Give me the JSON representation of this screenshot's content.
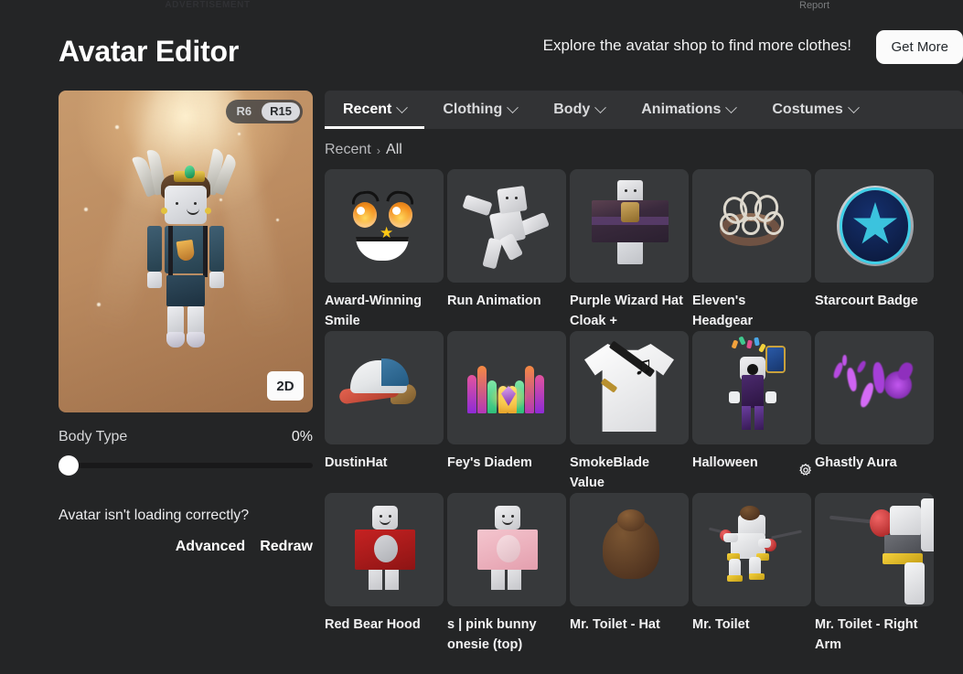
{
  "top": {
    "advertisement_label": "ADVERTISEMENT",
    "report_label": "Report"
  },
  "header": {
    "title": "Avatar Editor",
    "promo_text": "Explore the avatar shop to find more clothes!",
    "get_more_label": "Get More"
  },
  "avatar_panel": {
    "rig_options": [
      {
        "label": "R6",
        "active": false
      },
      {
        "label": "R15",
        "active": true
      }
    ],
    "view_toggle_label": "2D",
    "body_type_label": "Body Type",
    "body_type_value": "0%",
    "body_type_percent": 0,
    "loading_question": "Avatar isn't loading correctly?",
    "advanced_label": "Advanced",
    "redraw_label": "Redraw"
  },
  "tabs": [
    {
      "label": "Recent",
      "active": true
    },
    {
      "label": "Clothing",
      "active": false
    },
    {
      "label": "Body",
      "active": false
    },
    {
      "label": "Animations",
      "active": false
    },
    {
      "label": "Costumes",
      "active": false
    }
  ],
  "breadcrumb": {
    "root": "Recent",
    "separator": "›",
    "current": "All"
  },
  "items": [
    {
      "name": "Award-Winning Smile",
      "art": "smile-face"
    },
    {
      "name": "Run Animation",
      "art": "run-animation"
    },
    {
      "name": "Purple Wizard Hat Cloak +",
      "art": "purple-wizard"
    },
    {
      "name": "Eleven's Headgear",
      "art": "eleven-headgear"
    },
    {
      "name": "Starcourt Badge",
      "art": "starcourt-badge"
    },
    {
      "name": "DustinHat",
      "art": "dustin-hat"
    },
    {
      "name": "Fey's Diadem",
      "art": "feys-diadem"
    },
    {
      "name": "SmokeBlade Value",
      "art": "smokeblade-shirt"
    },
    {
      "name": "Halloween",
      "art": "halloween-costume"
    },
    {
      "name": "Ghastly Aura",
      "art": "ghastly-aura"
    },
    {
      "name": "Red Bear Hood",
      "art": "red-bear-hood"
    },
    {
      "name": "s | pink bunny onesie (top)",
      "art": "pink-bunny-onesie"
    },
    {
      "name": "Mr. Toilet - Hat",
      "art": "mr-toilet-hat"
    },
    {
      "name": "Mr. Toilet",
      "art": "mr-toilet"
    },
    {
      "name": "Mr. Toilet - Right Arm",
      "art": "mr-toilet-right-arm"
    }
  ],
  "colors": {
    "page_background": "#242526",
    "tab_bar": "#323335",
    "card": "#37393b",
    "accent_white": "#ffffff",
    "text_primary": "#f2f2f3",
    "text_muted": "#b9babd"
  }
}
